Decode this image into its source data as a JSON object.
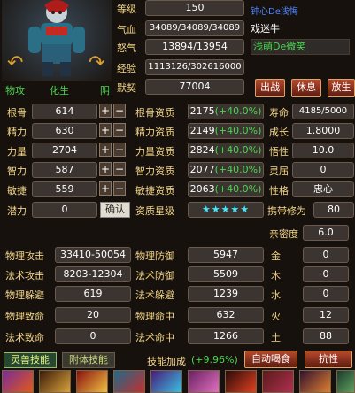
{
  "portrait": {
    "left_tag": "物攻",
    "mid_tag": "化生",
    "right_tag": "阴"
  },
  "top_stats": [
    {
      "label": "等级",
      "value": "150"
    },
    {
      "label": "气血",
      "value": "34089/34089/34089"
    },
    {
      "label": "怒气",
      "value": "13894/13954"
    },
    {
      "label": "经验",
      "value": "1113126/302616000"
    },
    {
      "label": "默契",
      "value": "77004"
    }
  ],
  "owner": {
    "title": "钟心De浅悔",
    "name": "戏迷牛",
    "guild": "浅萌De微笑"
  },
  "actions": {
    "battle": "出战",
    "rest": "休息",
    "release": "放生"
  },
  "attrs": [
    {
      "label": "根骨",
      "value": "614",
      "apt_label": "根骨资质",
      "apt": "2175",
      "pct": "(+40.0%)"
    },
    {
      "label": "精力",
      "value": "630",
      "apt_label": "精力资质",
      "apt": "2149",
      "pct": "(+40.0%)"
    },
    {
      "label": "力量",
      "value": "2704",
      "apt_label": "力量资质",
      "apt": "2824",
      "pct": "(+40.0%)"
    },
    {
      "label": "智力",
      "value": "587",
      "apt_label": "智力资质",
      "apt": "2077",
      "pct": "(+40.0%)"
    },
    {
      "label": "敏捷",
      "value": "559",
      "apt_label": "敏捷资质",
      "apt": "2063",
      "pct": "(+40.0%)"
    }
  ],
  "potential": {
    "label": "潜力",
    "value": "0",
    "confirm": "确认",
    "star_label": "资质星级",
    "stars": "★★★★★"
  },
  "right_info": [
    {
      "label": "寿命",
      "value": "4185/5000"
    },
    {
      "label": "成长",
      "value": "1.8000"
    },
    {
      "label": "悟性",
      "value": "10.0"
    },
    {
      "label": "灵届",
      "value": "0"
    },
    {
      "label": "性格",
      "value": "忠心"
    },
    {
      "label": "携带修为",
      "value": "80"
    },
    {
      "label": "亲密度",
      "value": "6.0"
    }
  ],
  "combat": [
    {
      "label": "物理攻击",
      "value": "33410-50054",
      "label2": "物理防御",
      "value2": "5947",
      "el": "金",
      "el_val": "0"
    },
    {
      "label": "法术攻击",
      "value": "8203-12304",
      "label2": "法术防御",
      "value2": "5509",
      "el": "木",
      "el_val": "0"
    },
    {
      "label": "物理躲避",
      "value": "619",
      "label2": "法术躲避",
      "value2": "1239",
      "el": "水",
      "el_val": "0"
    },
    {
      "label": "物理致命",
      "value": "20",
      "label2": "物理命中",
      "value2": "632",
      "el": "火",
      "el_val": "12"
    },
    {
      "label": "法术致命",
      "value": "0",
      "label2": "法术命中",
      "value2": "1266",
      "el": "土",
      "el_val": "88"
    }
  ],
  "bottom": {
    "tab1": "灵兽技能",
    "tab2": "附体技能",
    "skill_bonus_label": "技能加成",
    "skill_bonus_value": "(+9.96%)",
    "auto": "自动喝食",
    "resist": "抗性"
  }
}
